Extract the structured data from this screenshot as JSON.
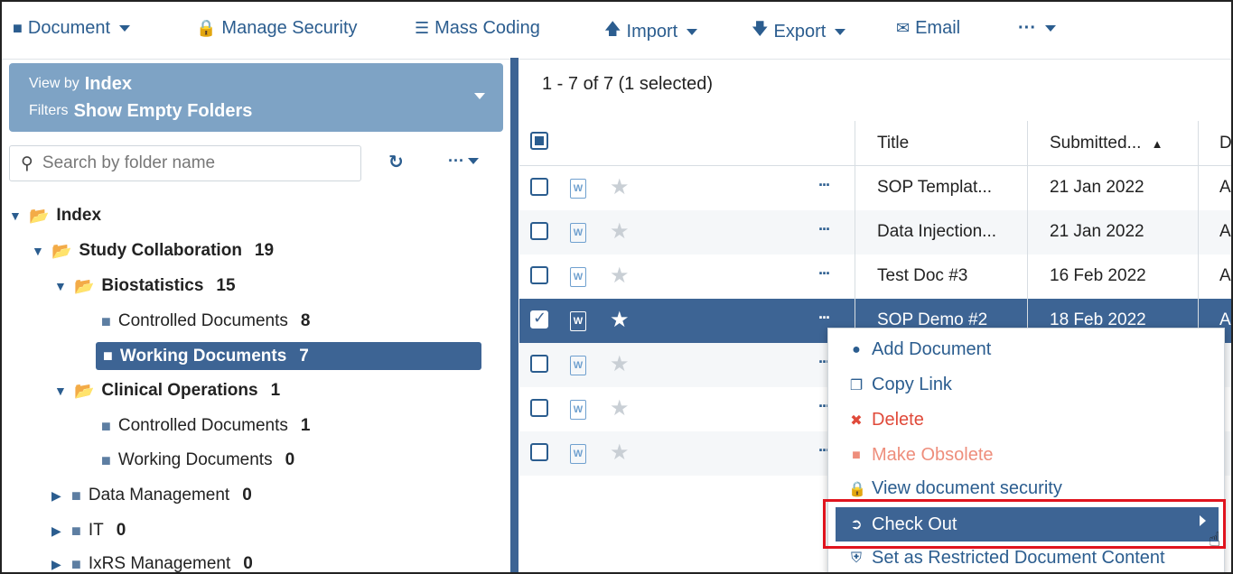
{
  "toolbar": {
    "document_label": "Document",
    "manage_security_label": "Manage Security",
    "mass_coding_label": "Mass Coding",
    "import_label": "Import",
    "export_label": "Export",
    "email_label": "Email",
    "more_label": "···"
  },
  "view": {
    "viewby_prefix": "View by",
    "viewby_value": "Index",
    "filters_prefix": "Filters",
    "filters_value": "Show Empty Folders"
  },
  "search": {
    "placeholder": "Search by folder name"
  },
  "tree": [
    {
      "label": "Index",
      "count": ""
    },
    {
      "label": "Study Collaboration",
      "count": "19"
    },
    {
      "label": "Biostatistics",
      "count": "15"
    },
    {
      "label": "Controlled Documents",
      "count": "8"
    },
    {
      "label": "Working Documents",
      "count": "7"
    },
    {
      "label": "Clinical Operations",
      "count": "1"
    },
    {
      "label": "Controlled Documents",
      "count": "1"
    },
    {
      "label": "Working Documents",
      "count": "0"
    },
    {
      "label": "Data Management",
      "count": "0"
    },
    {
      "label": "IT",
      "count": "0"
    },
    {
      "label": "IxRS Management",
      "count": "0"
    }
  ],
  "grid": {
    "count_text": "1 - 7 of 7 (1 selected)",
    "columns": [
      "Title",
      "Submitted...",
      "D"
    ],
    "rows": [
      {
        "title": "SOP Templat...",
        "submitted": "21 Jan 2022",
        "d": "A",
        "checked": false
      },
      {
        "title": "Data Injection...",
        "submitted": "21 Jan 2022",
        "d": "A",
        "checked": false
      },
      {
        "title": "Test Doc #3",
        "submitted": "16 Feb 2022",
        "d": "A",
        "checked": false
      },
      {
        "title": "SOP Demo #2",
        "submitted": "18 Feb 2022",
        "d": "A",
        "checked": true
      },
      {
        "title": "",
        "submitted": "",
        "d": "",
        "checked": false
      },
      {
        "title": "",
        "submitted": "",
        "d": "",
        "checked": false
      },
      {
        "title": "",
        "submitted": "",
        "d": "",
        "checked": false
      }
    ]
  },
  "context_menu": {
    "add_document": "Add Document",
    "copy_link": "Copy Link",
    "delete": "Delete",
    "make_obsolete": "Make Obsolete",
    "view_security": "View document security",
    "check_out": "Check Out",
    "set_restricted": "Set as Restricted Document Content"
  },
  "colors": {
    "accent": "#2b5d8f",
    "selected": "#3d6494",
    "viewby_bg": "#7ea3c5",
    "delete_red": "#e04a3a",
    "highlight_box": "#e0141e"
  }
}
